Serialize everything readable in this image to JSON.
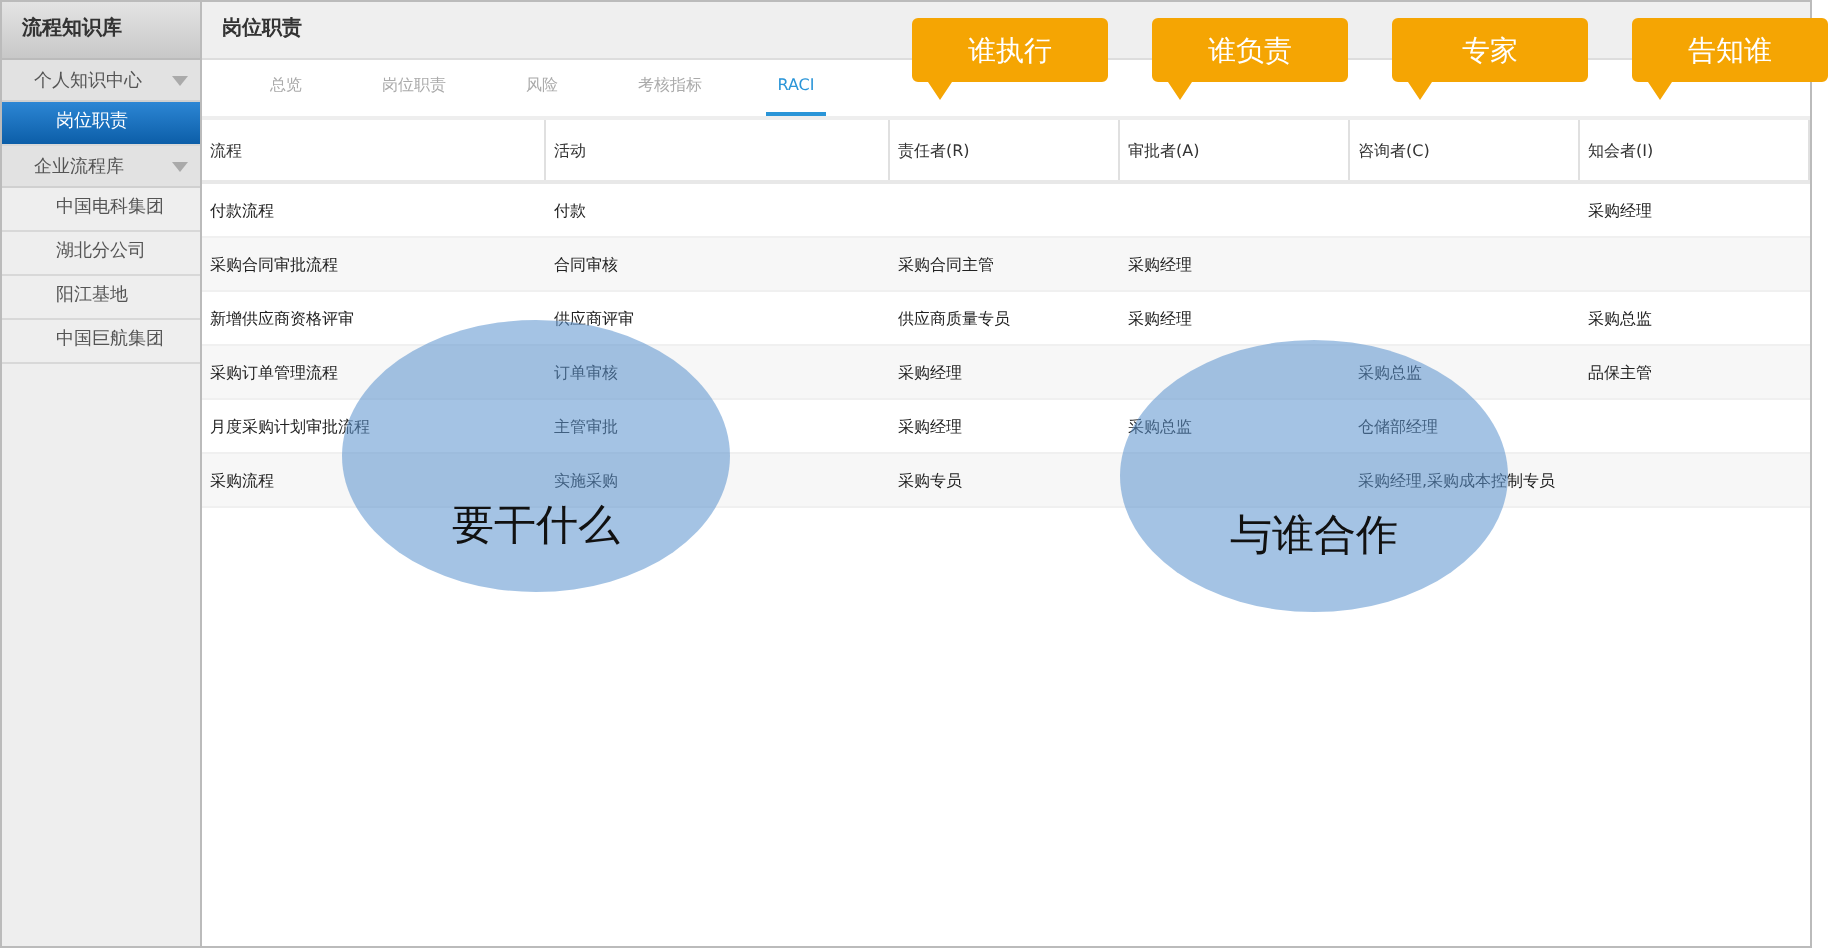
{
  "sidebar": {
    "title": "流程知识库",
    "items": [
      {
        "label": "个人知识中心",
        "kind": "group",
        "selected": false
      },
      {
        "label": "岗位职责",
        "kind": "item",
        "selected": true
      },
      {
        "label": "企业流程库",
        "kind": "group",
        "selected": false
      },
      {
        "label": "中国电科集团",
        "kind": "item",
        "selected": false
      },
      {
        "label": "湖北分公司",
        "kind": "item",
        "selected": false
      },
      {
        "label": "阳江基地",
        "kind": "item",
        "selected": false
      },
      {
        "label": "中国巨航集团",
        "kind": "item",
        "selected": false
      }
    ]
  },
  "header": {
    "title": "岗位职责"
  },
  "tabs": [
    {
      "label": "总览",
      "selected": false
    },
    {
      "label": "岗位职责",
      "selected": false
    },
    {
      "label": "风险",
      "selected": false
    },
    {
      "label": "考核指标",
      "selected": false
    },
    {
      "label": "RACI",
      "selected": true
    }
  ],
  "table": {
    "columns": [
      "流程",
      "活动",
      "责任者(R)",
      "审批者(A)",
      "咨询者(C)",
      "知会者(I)"
    ],
    "rows": [
      [
        "付款流程",
        "付款",
        "",
        "",
        "",
        "采购经理"
      ],
      [
        "采购合同审批流程",
        "合同审核",
        "采购合同主管",
        "采购经理",
        "",
        ""
      ],
      [
        "新增供应商资格评审",
        "供应商评审",
        "供应商质量专员",
        "采购经理",
        "",
        "采购总监"
      ],
      [
        "采购订单管理流程",
        "订单审核",
        "采购经理",
        "",
        "采购总监",
        "品保主管"
      ],
      [
        "月度采购计划审批流程",
        "主管审批",
        "采购经理",
        "采购总监",
        "仓储部经理",
        ""
      ],
      [
        "采购流程",
        "实施采购",
        "采购专员",
        "",
        "采购经理,采购成本控制专员",
        ""
      ]
    ]
  },
  "callouts": [
    "谁执行",
    "谁负责",
    "专家",
    "告知谁"
  ],
  "bubbles": [
    "要干什么",
    "与谁合作"
  ]
}
